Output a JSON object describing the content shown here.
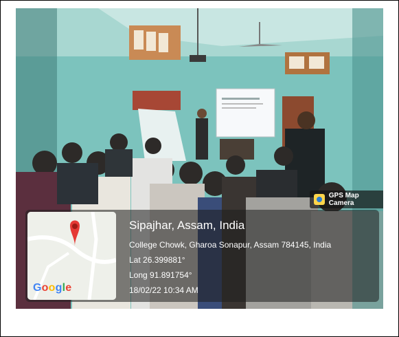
{
  "stamp": {
    "badge_text": "GPS Map Camera",
    "title": "Sipajhar, Assam, India",
    "address": "College Chowk, Gharoa Sonapur, Assam 784145, India",
    "latitude": "Lat 26.399881°",
    "longitude": "Long 91.891754°",
    "datetime": "18/02/22 10:34 AM"
  },
  "map": {
    "brand": "Google",
    "pin_color": "#e53935"
  }
}
